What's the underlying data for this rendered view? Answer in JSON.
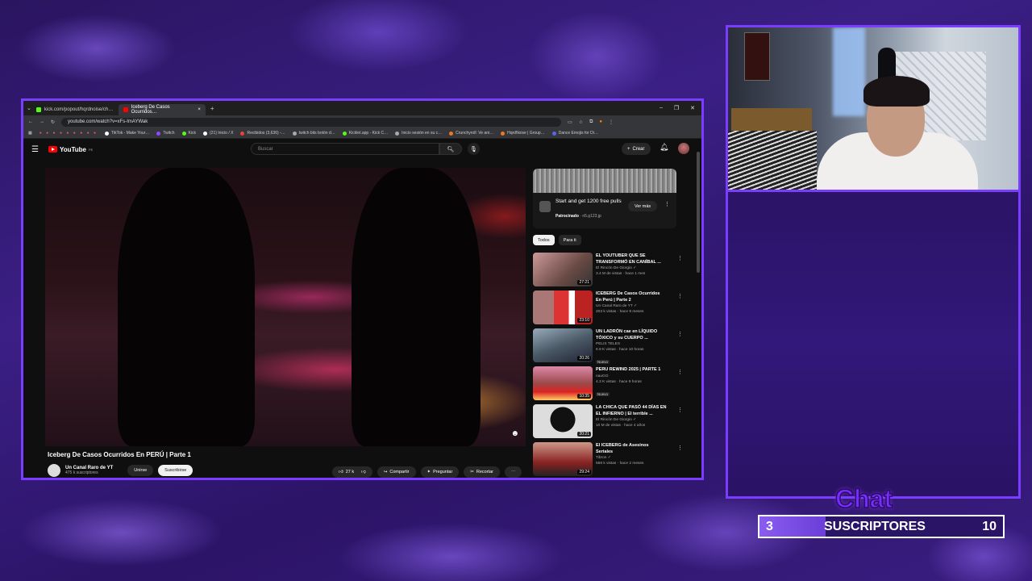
{
  "browser": {
    "tabs": [
      {
        "label": "kick.com/popout/hqrdnoise/ch…",
        "favicon_color": "#53fc18"
      },
      {
        "label": "Iceberg De Casos Ocurridos…",
        "favicon_color": "#ff0000"
      }
    ],
    "new_tab": "+",
    "url": "youtube.com/watch?v=xFs-ImAYWak",
    "bookmarks": [
      {
        "label": "TikTok - Make Your…",
        "color": "#fff"
      },
      {
        "label": "Twitch",
        "color": "#9146ff"
      },
      {
        "label": "Kick",
        "color": "#53fc18"
      },
      {
        "label": "(21) Inicio / X",
        "color": "#fff"
      },
      {
        "label": "Recibidos (3,636) -…",
        "color": "#ea4335"
      },
      {
        "label": "twitch bits botón d…",
        "color": "#aaa"
      },
      {
        "label": "Kicklet.app - Kick C…",
        "color": "#53fc18"
      },
      {
        "label": "Inicio sesión en su c…",
        "color": "#aaa"
      },
      {
        "label": "Crunchyroll: Ve ani…",
        "color": "#f47521"
      },
      {
        "label": "HqrdNoise | Group…",
        "color": "#f47521"
      },
      {
        "label": "Dance Emojis for Di…",
        "color": "#5865f2"
      }
    ]
  },
  "youtube": {
    "logo": "YouTube",
    "logo_region": "PE",
    "search_placeholder": "Buscar",
    "create_label": "Crear",
    "video_title": "Iceberg De Casos Ocurridos En PERÚ | Parte 1",
    "channel_name": "Un Canal Raro de YT",
    "subscribers": "475 k suscriptores",
    "join_label": "Unirse",
    "subscribe_label": "Suscribirse",
    "likes": "27 k",
    "share_label": "Compartir",
    "ask_label": "Preguntar",
    "clip_label": "Recortar",
    "ad": {
      "title": "Start and get 1200 free pulls",
      "sponsor": "Patrocinado",
      "domain": "· n5.g123.jp",
      "button": "Ver más"
    },
    "chips": [
      "Todos",
      "Para ti"
    ],
    "recommendations": [
      {
        "title": "EL YOUTUBER QUE SE TRANSFORMÓ EN CANÍBAL ...",
        "channel": "El Rincón De Giorgio ✓",
        "meta": "3.4 M de vistas · hace 1 mes",
        "duration": "27:21",
        "badge": "",
        "thumb": "#6a4a44"
      },
      {
        "title": "ICEBERG De Casos Ocurridos En Perú | Parte 2",
        "channel": "Un Canal Raro de YT ✓",
        "meta": "203 k vistas · hace 9 meses",
        "duration": "23:10",
        "badge": "",
        "thumb": "#8a3a3a"
      },
      {
        "title": "UN LADRÓN cae en LÍQUIDO TÓXICO y su CUERPO ...",
        "channel": "PELIS TELES",
        "meta": "6.9 K vistas · hace 10 horas",
        "duration": "20:26",
        "badge": "Nuevo",
        "thumb": "#4a5a66"
      },
      {
        "title": "PERU REWIND 2025 | PARTE 1",
        "channel": "nauGO",
        "meta": "4.3 K vistas · hace 9 horas",
        "duration": "10:35",
        "badge": "Nuevo",
        "thumb": "#9a4a4a"
      },
      {
        "title": "LA CHICA QUE PASÓ 44 DÍAS EN EL INFIERNO | El terrible ...",
        "channel": "El Rincón De Giorgio ✓",
        "meta": "10 M de vistas · hace 4 años",
        "duration": "20:21",
        "badge": "",
        "thumb": "#cfcfcf"
      },
      {
        "title": "El ICEBERG de Asesinos Seriales",
        "channel": "Tibron ✓",
        "meta": "558 k vistas · hace 2 meses",
        "duration": "29:24",
        "badge": "",
        "thumb": "#8a2222"
      }
    ]
  },
  "overlay": {
    "chat_title": "Chat",
    "goal": {
      "current": "3",
      "label": "SUSCRIPTORES",
      "target": "10",
      "progress": 0.27
    }
  },
  "colors": {
    "accent": "#7a3cff",
    "yt_red": "#ff0000"
  }
}
